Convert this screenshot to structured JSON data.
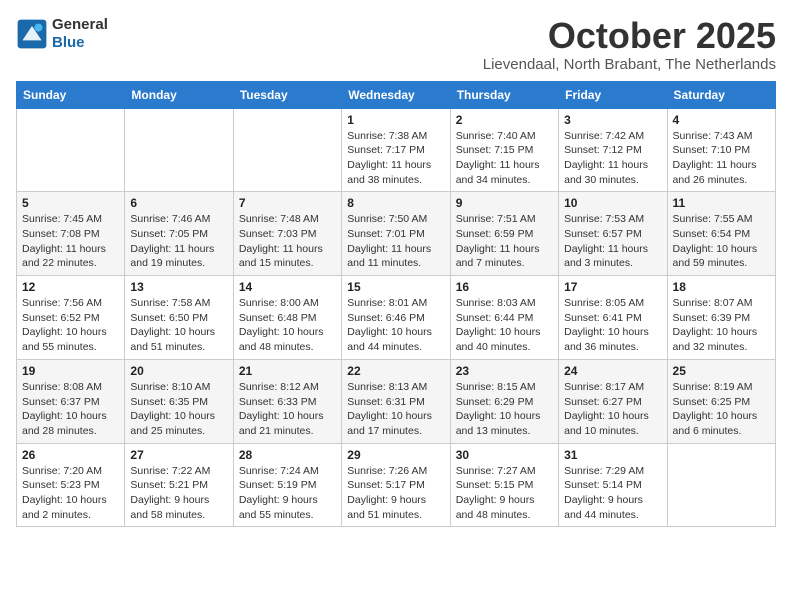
{
  "logo": {
    "general": "General",
    "blue": "Blue"
  },
  "title": "October 2025",
  "location": "Lievendaal, North Brabant, The Netherlands",
  "weekdays": [
    "Sunday",
    "Monday",
    "Tuesday",
    "Wednesday",
    "Thursday",
    "Friday",
    "Saturday"
  ],
  "weeks": [
    [
      {
        "day": "",
        "info": ""
      },
      {
        "day": "",
        "info": ""
      },
      {
        "day": "",
        "info": ""
      },
      {
        "day": "1",
        "info": "Sunrise: 7:38 AM\nSunset: 7:17 PM\nDaylight: 11 hours and 38 minutes."
      },
      {
        "day": "2",
        "info": "Sunrise: 7:40 AM\nSunset: 7:15 PM\nDaylight: 11 hours and 34 minutes."
      },
      {
        "day": "3",
        "info": "Sunrise: 7:42 AM\nSunset: 7:12 PM\nDaylight: 11 hours and 30 minutes."
      },
      {
        "day": "4",
        "info": "Sunrise: 7:43 AM\nSunset: 7:10 PM\nDaylight: 11 hours and 26 minutes."
      }
    ],
    [
      {
        "day": "5",
        "info": "Sunrise: 7:45 AM\nSunset: 7:08 PM\nDaylight: 11 hours and 22 minutes."
      },
      {
        "day": "6",
        "info": "Sunrise: 7:46 AM\nSunset: 7:05 PM\nDaylight: 11 hours and 19 minutes."
      },
      {
        "day": "7",
        "info": "Sunrise: 7:48 AM\nSunset: 7:03 PM\nDaylight: 11 hours and 15 minutes."
      },
      {
        "day": "8",
        "info": "Sunrise: 7:50 AM\nSunset: 7:01 PM\nDaylight: 11 hours and 11 minutes."
      },
      {
        "day": "9",
        "info": "Sunrise: 7:51 AM\nSunset: 6:59 PM\nDaylight: 11 hours and 7 minutes."
      },
      {
        "day": "10",
        "info": "Sunrise: 7:53 AM\nSunset: 6:57 PM\nDaylight: 11 hours and 3 minutes."
      },
      {
        "day": "11",
        "info": "Sunrise: 7:55 AM\nSunset: 6:54 PM\nDaylight: 10 hours and 59 minutes."
      }
    ],
    [
      {
        "day": "12",
        "info": "Sunrise: 7:56 AM\nSunset: 6:52 PM\nDaylight: 10 hours and 55 minutes."
      },
      {
        "day": "13",
        "info": "Sunrise: 7:58 AM\nSunset: 6:50 PM\nDaylight: 10 hours and 51 minutes."
      },
      {
        "day": "14",
        "info": "Sunrise: 8:00 AM\nSunset: 6:48 PM\nDaylight: 10 hours and 48 minutes."
      },
      {
        "day": "15",
        "info": "Sunrise: 8:01 AM\nSunset: 6:46 PM\nDaylight: 10 hours and 44 minutes."
      },
      {
        "day": "16",
        "info": "Sunrise: 8:03 AM\nSunset: 6:44 PM\nDaylight: 10 hours and 40 minutes."
      },
      {
        "day": "17",
        "info": "Sunrise: 8:05 AM\nSunset: 6:41 PM\nDaylight: 10 hours and 36 minutes."
      },
      {
        "day": "18",
        "info": "Sunrise: 8:07 AM\nSunset: 6:39 PM\nDaylight: 10 hours and 32 minutes."
      }
    ],
    [
      {
        "day": "19",
        "info": "Sunrise: 8:08 AM\nSunset: 6:37 PM\nDaylight: 10 hours and 28 minutes."
      },
      {
        "day": "20",
        "info": "Sunrise: 8:10 AM\nSunset: 6:35 PM\nDaylight: 10 hours and 25 minutes."
      },
      {
        "day": "21",
        "info": "Sunrise: 8:12 AM\nSunset: 6:33 PM\nDaylight: 10 hours and 21 minutes."
      },
      {
        "day": "22",
        "info": "Sunrise: 8:13 AM\nSunset: 6:31 PM\nDaylight: 10 hours and 17 minutes."
      },
      {
        "day": "23",
        "info": "Sunrise: 8:15 AM\nSunset: 6:29 PM\nDaylight: 10 hours and 13 minutes."
      },
      {
        "day": "24",
        "info": "Sunrise: 8:17 AM\nSunset: 6:27 PM\nDaylight: 10 hours and 10 minutes."
      },
      {
        "day": "25",
        "info": "Sunrise: 8:19 AM\nSunset: 6:25 PM\nDaylight: 10 hours and 6 minutes."
      }
    ],
    [
      {
        "day": "26",
        "info": "Sunrise: 7:20 AM\nSunset: 5:23 PM\nDaylight: 10 hours and 2 minutes."
      },
      {
        "day": "27",
        "info": "Sunrise: 7:22 AM\nSunset: 5:21 PM\nDaylight: 9 hours and 58 minutes."
      },
      {
        "day": "28",
        "info": "Sunrise: 7:24 AM\nSunset: 5:19 PM\nDaylight: 9 hours and 55 minutes."
      },
      {
        "day": "29",
        "info": "Sunrise: 7:26 AM\nSunset: 5:17 PM\nDaylight: 9 hours and 51 minutes."
      },
      {
        "day": "30",
        "info": "Sunrise: 7:27 AM\nSunset: 5:15 PM\nDaylight: 9 hours and 48 minutes."
      },
      {
        "day": "31",
        "info": "Sunrise: 7:29 AM\nSunset: 5:14 PM\nDaylight: 9 hours and 44 minutes."
      },
      {
        "day": "",
        "info": ""
      }
    ]
  ]
}
